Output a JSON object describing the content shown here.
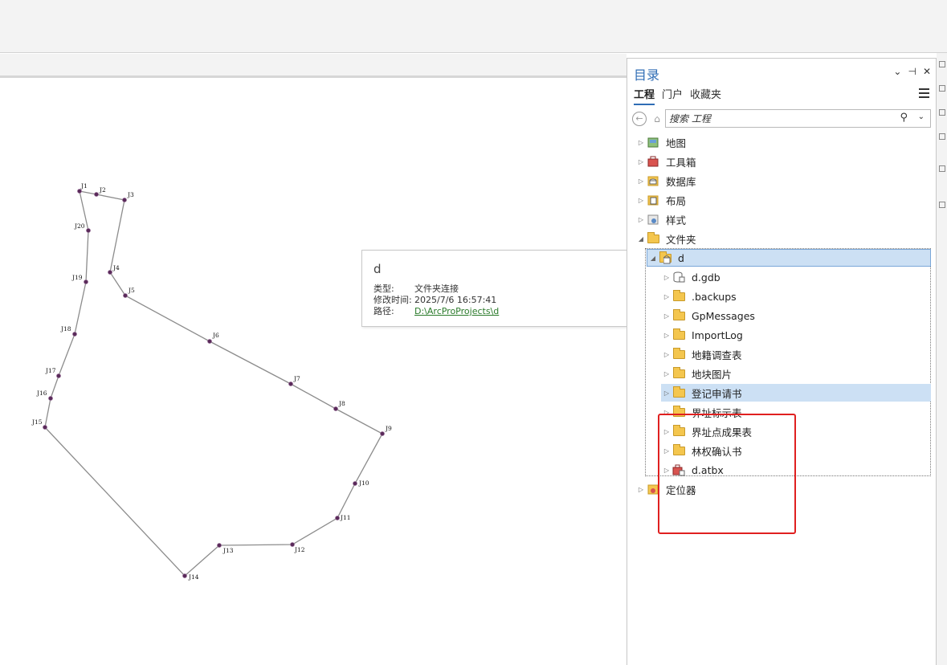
{
  "map": {
    "points": [
      {
        "label": "J1"
      },
      {
        "label": "J2"
      },
      {
        "label": "J3"
      },
      {
        "label": "J4"
      },
      {
        "label": "J5"
      },
      {
        "label": "J6"
      },
      {
        "label": "J7"
      },
      {
        "label": "J8"
      },
      {
        "label": "J9"
      },
      {
        "label": "J10"
      },
      {
        "label": "J11"
      },
      {
        "label": "J12"
      },
      {
        "label": "J13"
      },
      {
        "label": "J14"
      },
      {
        "label": "J15"
      },
      {
        "label": "J16"
      },
      {
        "label": "J17"
      },
      {
        "label": "J18"
      },
      {
        "label": "J19"
      },
      {
        "label": "J20"
      }
    ],
    "line_color": "#8c8c8c",
    "vertex_color": "#5a2a5a"
  },
  "tooltip": {
    "title": "d",
    "type_label": "类型:",
    "type_value": "文件夹连接",
    "modified_label": "修改时间:",
    "modified_value": "2025/7/6 16:57:41",
    "path_label": "路径:",
    "path_value": "D:\\ArcProProjects\\d"
  },
  "catalog": {
    "title": "目录",
    "tabs": [
      "工程",
      "门户",
      "收藏夹"
    ],
    "search_placeholder": "搜索 工程",
    "tree": [
      {
        "label": "地图",
        "icon": "map-icon"
      },
      {
        "label": "工具箱",
        "icon": "toolbox-icon"
      },
      {
        "label": "数据库",
        "icon": "database-icon"
      },
      {
        "label": "布局",
        "icon": "layout-icon"
      },
      {
        "label": "样式",
        "icon": "style-icon"
      },
      {
        "label": "文件夹",
        "icon": "folder-icon"
      },
      {
        "label": "d",
        "icon": "folder-connection-icon"
      },
      {
        "label": "d.gdb",
        "icon": "geodatabase-icon"
      },
      {
        "label": ".backups",
        "icon": "folder-icon"
      },
      {
        "label": "GpMessages",
        "icon": "folder-icon"
      },
      {
        "label": "ImportLog",
        "icon": "folder-icon"
      },
      {
        "label": "地籍调查表",
        "icon": "folder-icon"
      },
      {
        "label": "地块图片",
        "icon": "folder-icon"
      },
      {
        "label": "登记申请书",
        "icon": "folder-icon"
      },
      {
        "label": "界址标示表",
        "icon": "folder-icon"
      },
      {
        "label": "界址点成果表",
        "icon": "folder-icon"
      },
      {
        "label": "林权确认书",
        "icon": "folder-icon"
      },
      {
        "label": "d.atbx",
        "icon": "toolbox-file-icon"
      },
      {
        "label": "定位器",
        "icon": "locator-icon"
      }
    ],
    "accent_color": "#2f6db5",
    "highlight_color": "#e02020"
  }
}
